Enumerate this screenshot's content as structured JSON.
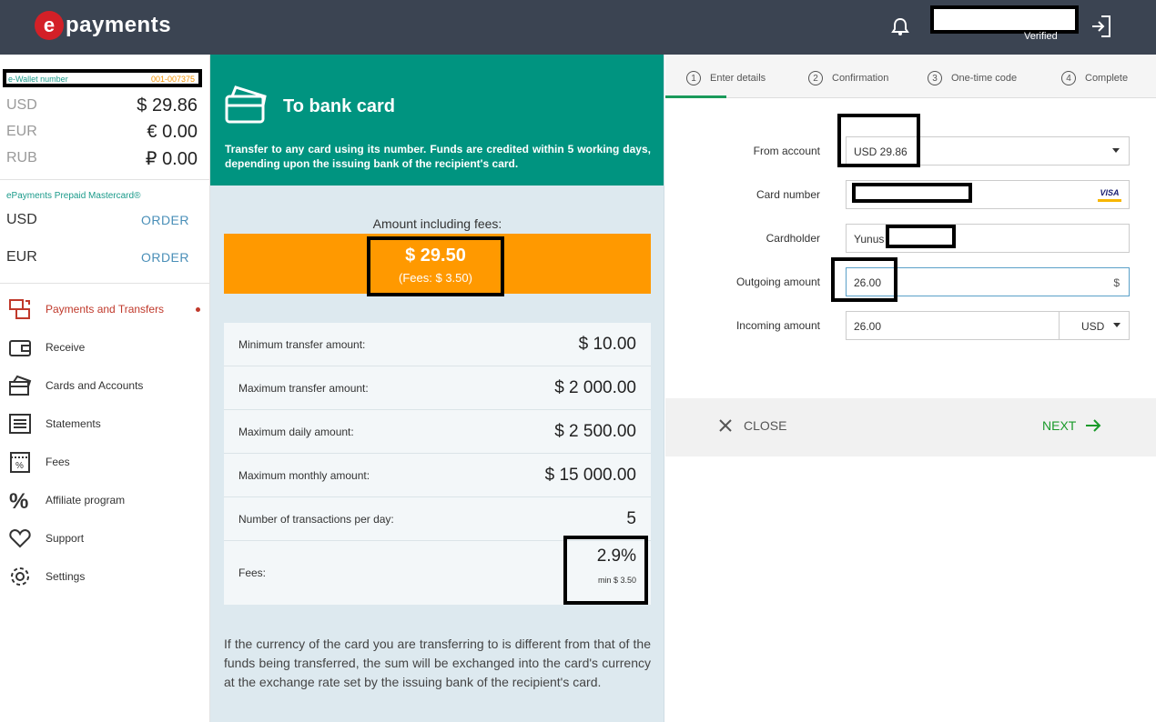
{
  "header": {
    "logo_letter": "e",
    "logo_text": "payments",
    "verified": "Verified"
  },
  "sidebar": {
    "wallet_label": "e-Wallet number",
    "wallet_number": "001-007375",
    "balances": [
      {
        "currency": "USD",
        "value": "$ 29.86"
      },
      {
        "currency": "EUR",
        "value": "€ 0.00"
      },
      {
        "currency": "RUB",
        "value": "₽ 0.00"
      }
    ],
    "card_title": "ePayments Prepaid Mastercard®",
    "card_orders": [
      {
        "currency": "USD",
        "action": "ORDER"
      },
      {
        "currency": "EUR",
        "action": "ORDER"
      }
    ],
    "nav": [
      {
        "label": "Payments and Transfers"
      },
      {
        "label": "Receive"
      },
      {
        "label": "Cards and Accounts"
      },
      {
        "label": "Statements"
      },
      {
        "label": "Fees"
      },
      {
        "label": "Affiliate program"
      },
      {
        "label": "Support"
      },
      {
        "label": "Settings"
      }
    ]
  },
  "transfer_info": {
    "title": "To bank card",
    "description": "Transfer to any card using its number. Funds are credited within 5 working days, depending upon the issuing bank of the recipient's card.",
    "amount_label": "Amount including fees:",
    "amount_value": "$ 29.50",
    "amount_fees": "(Fees: $ 3.50)",
    "limits": [
      {
        "label": "Minimum transfer amount:",
        "value": "$ 10.00"
      },
      {
        "label": "Maximum transfer amount:",
        "value": "$ 2 000.00"
      },
      {
        "label": "Maximum daily amount:",
        "value": "$ 2 500.00"
      },
      {
        "label": "Maximum monthly amount:",
        "value": "$ 15 000.00"
      },
      {
        "label": "Number of transactions per day:",
        "value": "5"
      }
    ],
    "fees_label": "Fees:",
    "fees_percent": "2.9%",
    "fees_min": "min $ 3.50",
    "note": "If the currency of the card you are transferring to is different from that of the funds being transferred, the sum will be exchanged into the card's currency at the exchange rate set by the issuing bank of the recipient's card."
  },
  "steps": [
    {
      "num": "1",
      "label": "Enter details"
    },
    {
      "num": "2",
      "label": "Confirmation"
    },
    {
      "num": "3",
      "label": "One-time code"
    },
    {
      "num": "4",
      "label": "Complete"
    }
  ],
  "form": {
    "from_account_label": "From account",
    "from_account_value": "USD 29.86",
    "card_number_label": "Card number",
    "card_brand": "VISA",
    "cardholder_label": "Cardholder",
    "cardholder_value": "Yunus",
    "outgoing_label": "Outgoing amount",
    "outgoing_value": "26.00",
    "outgoing_currency_symbol": "$",
    "incoming_label": "Incoming amount",
    "incoming_value": "26.00",
    "incoming_currency": "USD"
  },
  "actions": {
    "close": "CLOSE",
    "next": "NEXT"
  },
  "colors": {
    "topbar": "#3b4452",
    "teal": "#009480",
    "orange": "#ff9900",
    "accent_red": "#c0392b",
    "next_green": "#1a9a2a"
  }
}
